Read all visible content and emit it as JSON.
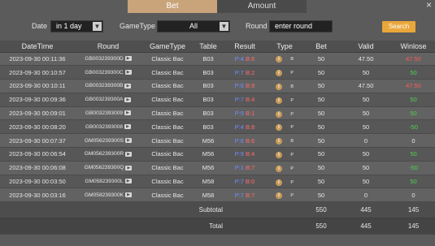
{
  "tabs": [
    {
      "label": "Bet",
      "active": true
    },
    {
      "label": "Amount",
      "active": false
    }
  ],
  "close_label": "×",
  "filter": {
    "date_label": "Date",
    "date_value": "in 1 day",
    "gametype_label": "GameType",
    "gametype_value": "All",
    "round_label": "Round",
    "round_placeholder": "enter round",
    "search_label": "Search"
  },
  "columns": [
    "DateTime",
    "Round",
    "GameType",
    "Table",
    "Result",
    "Type",
    "Bet",
    "Valid",
    "Winlose"
  ],
  "rows": [
    {
      "datetime": "2023-09-30 00:11:36",
      "round": "GB003239300D",
      "gametype": "Classic Bac",
      "table": "B03",
      "p": "P:4",
      "b": "B:6",
      "type": "B",
      "bet": "50",
      "valid": "47.50",
      "winlose": "47.50",
      "wl": "neg"
    },
    {
      "datetime": "2023-09-30 00:10:57",
      "round": "GB003239300C",
      "gametype": "Classic Bac",
      "table": "B03",
      "p": "P:7",
      "b": "B:2",
      "type": "P",
      "bet": "50",
      "valid": "50",
      "winlose": "50",
      "wl": "pos"
    },
    {
      "datetime": "2023-09-30 00:10:11",
      "round": "GB003239300B",
      "gametype": "Classic Bac",
      "table": "B03",
      "p": "P:6",
      "b": "B:9",
      "type": "B",
      "bet": "50",
      "valid": "47.50",
      "winlose": "47.50",
      "wl": "neg"
    },
    {
      "datetime": "2023-09-30 00:09:36",
      "round": "GB003239300A",
      "gametype": "Classic Bac",
      "table": "B03",
      "p": "P:7",
      "b": "B:4",
      "type": "P",
      "bet": "50",
      "valid": "50",
      "winlose": "50",
      "wl": "pos"
    },
    {
      "datetime": "2023-09-30 00:09:01",
      "round": "GB0032393009",
      "gametype": "Classic Bac",
      "table": "B03",
      "p": "P:9",
      "b": "B:1",
      "type": "P",
      "bet": "50",
      "valid": "50",
      "winlose": "50",
      "wl": "pos"
    },
    {
      "datetime": "2023-09-30 00:08:20",
      "round": "GB0032393008",
      "gametype": "Classic Bac",
      "table": "B03",
      "p": "P:4",
      "b": "B:8",
      "type": "P",
      "bet": "50",
      "valid": "50",
      "winlose": "-50",
      "wl": "pos"
    },
    {
      "datetime": "2023-09-30 00:07:37",
      "round": "GM056239300S",
      "gametype": "Classic Bac",
      "table": "M56",
      "p": "P:6",
      "b": "B:6",
      "type": "B",
      "bet": "50",
      "valid": "0",
      "winlose": "0",
      "wl": "zero"
    },
    {
      "datetime": "2023-09-30 00:06:54",
      "round": "GM056239300R",
      "gametype": "Classic Bac",
      "table": "M56",
      "p": "P:9",
      "b": "B:4",
      "type": "P",
      "bet": "50",
      "valid": "50",
      "winlose": "50",
      "wl": "pos"
    },
    {
      "datetime": "2023-09-30 00:06:08",
      "round": "GM056239300Q",
      "gametype": "Classic Bac",
      "table": "M56",
      "p": "P:1",
      "b": "B:7",
      "type": "P",
      "bet": "50",
      "valid": "50",
      "winlose": "-50",
      "wl": "pos"
    },
    {
      "datetime": "2023-09-30 00:03:50",
      "round": "GM058239300L",
      "gametype": "Classic Bac",
      "table": "M58",
      "p": "P:7",
      "b": "B:0",
      "type": "P",
      "bet": "50",
      "valid": "50",
      "winlose": "50",
      "wl": "pos"
    },
    {
      "datetime": "2023-09-30 00:03:16",
      "round": "GM058239300K",
      "gametype": "Classic Bac",
      "table": "M58",
      "p": "P:7",
      "b": "B:7",
      "type": "P",
      "bet": "50",
      "valid": "0",
      "winlose": "0",
      "wl": "zero"
    }
  ],
  "subtotal": {
    "label": "Subtotal",
    "bet": "550",
    "valid": "445",
    "winlose": "145"
  },
  "total": {
    "label": "Total",
    "bet": "550",
    "valid": "445",
    "winlose": "145"
  },
  "colors": {
    "accent": "#c9a37a",
    "search": "#e9a73b",
    "player": "#6f8dff",
    "banker": "#ff6b6b",
    "win": "#4fd34f",
    "lose": "#ff5a5a"
  },
  "icons": {
    "round_action": "play-icon",
    "result_info": "info-icon",
    "dropdown": "chevron-down-icon"
  }
}
